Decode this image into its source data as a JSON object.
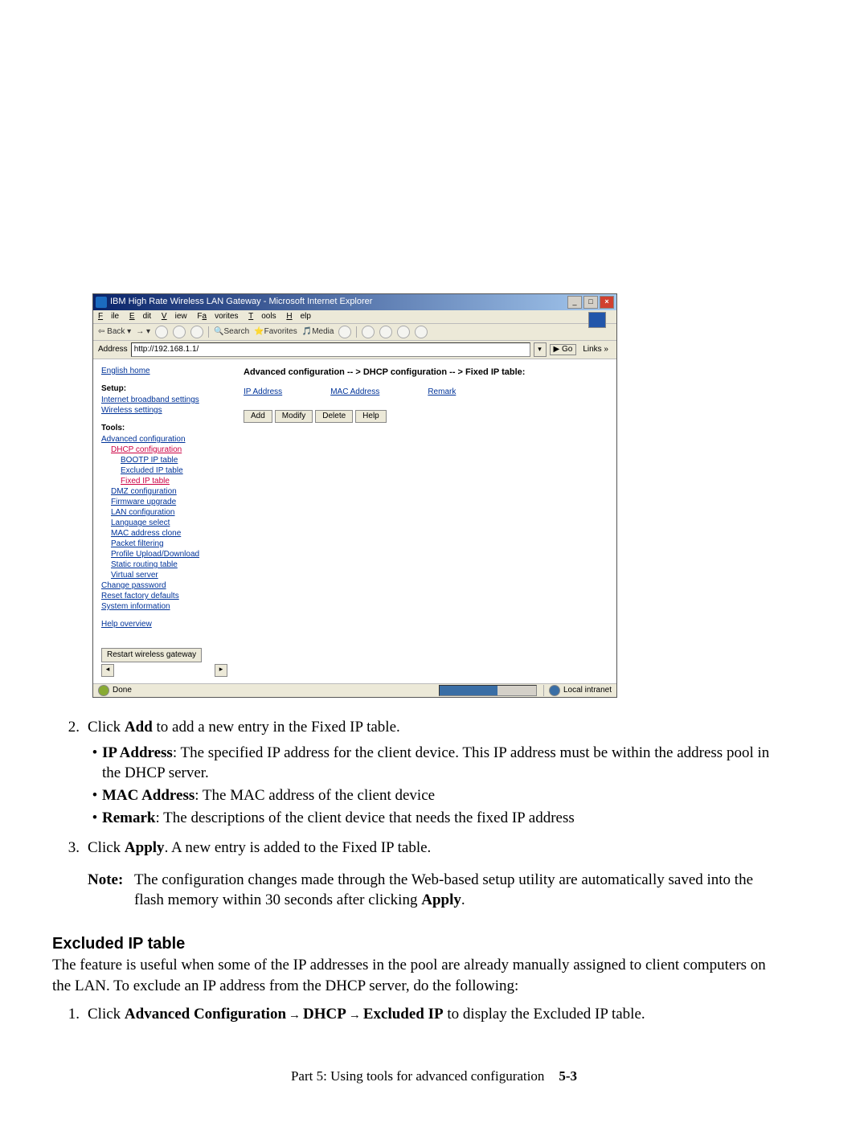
{
  "screenshot": {
    "title": "IBM High Rate Wireless LAN Gateway - Microsoft Internet Explorer",
    "menus": [
      "File",
      "Edit",
      "View",
      "Favorites",
      "Tools",
      "Help"
    ],
    "toolbar": {
      "back": "Back",
      "search": "Search",
      "favorites": "Favorites",
      "media": "Media"
    },
    "address_label": "Address",
    "address_value": "http://192.168.1.1/",
    "go": "Go",
    "links": "Links »",
    "sidebar": {
      "home": "English home",
      "setup_hdr": "Setup:",
      "setup": [
        "Internet broadband settings",
        "Wireless settings"
      ],
      "tools_hdr": "Tools:",
      "adv": "Advanced configuration",
      "dhcp": "DHCP configuration",
      "dhcp_sub": [
        "BOOTP IP table",
        "Excluded IP table",
        "Fixed IP table"
      ],
      "other": [
        "DMZ configuration",
        "Firmware upgrade",
        "LAN configuration",
        "Language select",
        "MAC address clone",
        "Packet filtering",
        "Profile Upload/Download",
        "Static routing table",
        "Virtual server"
      ],
      "misc": [
        "Change password",
        "Reset factory defaults",
        "System information"
      ],
      "help": "Help overview",
      "restart": "Restart wireless gateway"
    },
    "breadcrumb": "Advanced configuration -- > DHCP configuration -- > Fixed IP table:",
    "cols": [
      "IP Address",
      "MAC Address",
      "Remark"
    ],
    "buttons": [
      "Add",
      "Modify",
      "Delete",
      "Help"
    ],
    "status_done": "Done",
    "status_zone": "Local intranet"
  },
  "doc": {
    "step2_num": "2.",
    "step2_a": "Click ",
    "step2_b": "Add",
    "step2_c": " to add a new entry in the Fixed IP table.",
    "b1_a": "IP Address",
    "b1_b": ": The specified IP address for the client device. This IP address must be within the address pool in the DHCP server.",
    "b2_a": "MAC Address",
    "b2_b": ": The MAC address of the client device",
    "b3_a": "Remark",
    "b3_b": ": The descriptions of the client device that needs the fixed IP address",
    "step3_num": "3.",
    "step3_a": "Click ",
    "step3_b": "Apply",
    "step3_c": ". A new entry is added to the Fixed IP table.",
    "note_label": "Note:",
    "note_a": "The configuration changes made through the Web-based setup utility are automatically saved into the flash memory within 30 seconds after clicking ",
    "note_b": "Apply",
    "note_c": ".",
    "h4": "Excluded IP table",
    "para": "The feature is useful when some of the IP addresses in the pool are already manually assigned to client computers on the LAN. To exclude an IP address from the DHCP server, do the following:",
    "ex1_num": "1.",
    "ex1_a": "Click ",
    "ex1_b": "Advanced Configuration",
    "ex1_c": "DHCP",
    "ex1_d": "Excluded IP",
    "ex1_e": " to display the Excluded IP table.",
    "arrow": "→"
  },
  "footer": {
    "text": "Part 5: Using tools for advanced configuration",
    "page": "5-3"
  }
}
